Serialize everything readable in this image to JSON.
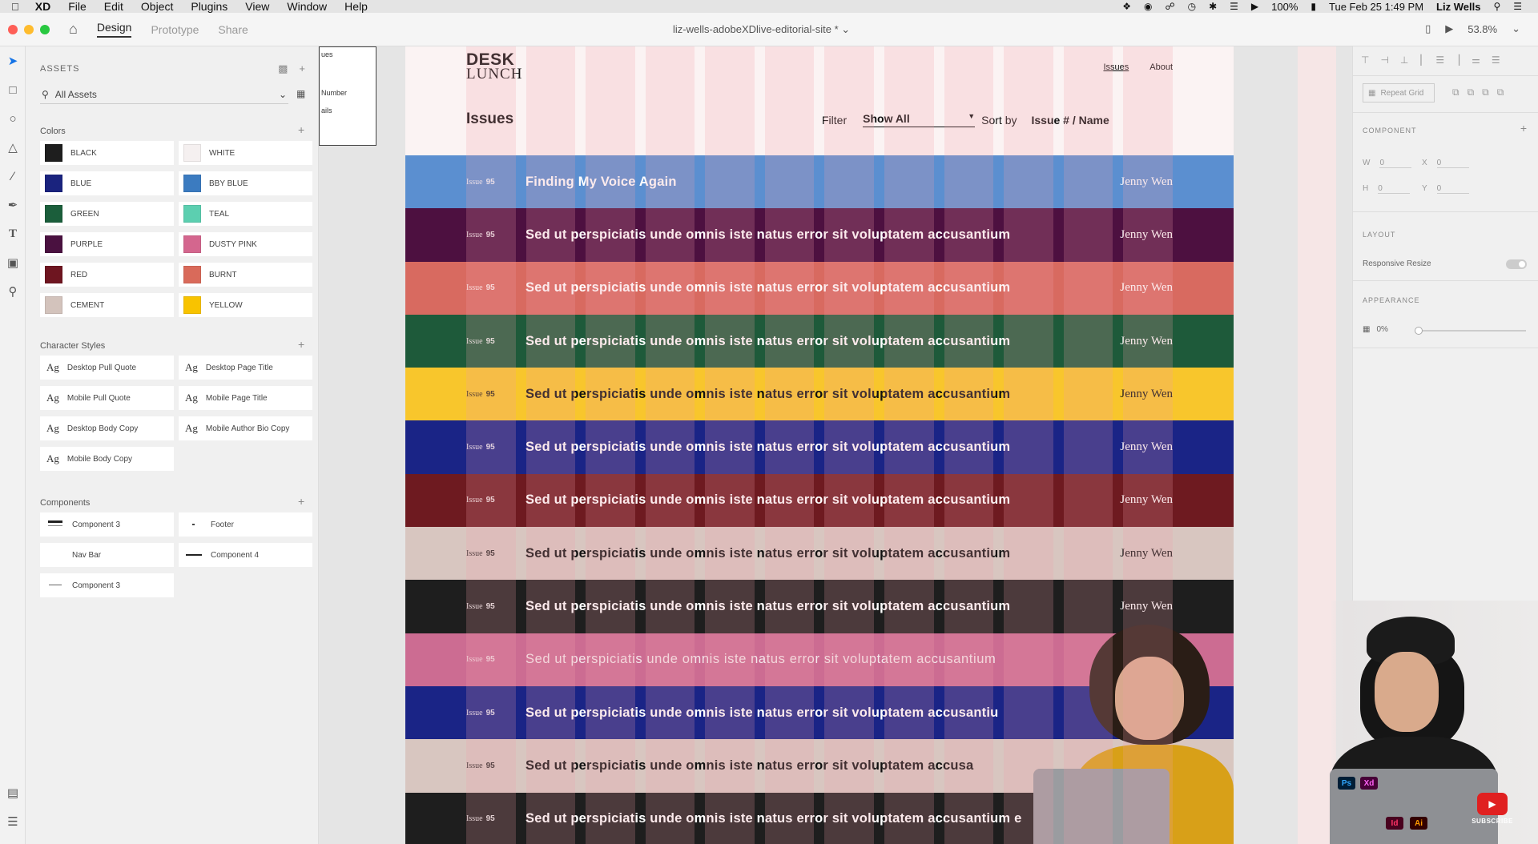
{
  "menubar": {
    "app": "XD",
    "items": [
      "File",
      "Edit",
      "Object",
      "Plugins",
      "View",
      "Window",
      "Help"
    ],
    "battery": "100%",
    "clock": "Tue Feb 25  1:49 PM",
    "user": "Liz Wells"
  },
  "titlebar": {
    "tabs": [
      "Design",
      "Prototype",
      "Share"
    ],
    "document": "liz-wells-adobeXDlive-editorial-site *",
    "zoom": "53.8%"
  },
  "assets": {
    "header": "ASSETS",
    "search_value": "All Assets",
    "colors_title": "Colors",
    "colors": [
      {
        "name": "BLACK",
        "hex": "#1e1e1e"
      },
      {
        "name": "WHITE",
        "hex": "#f5f0f0"
      },
      {
        "name": "BLUE",
        "hex": "#1a237e"
      },
      {
        "name": "BBY BLUE",
        "hex": "#3b7bc0"
      },
      {
        "name": "GREEN",
        "hex": "#1b5e3b"
      },
      {
        "name": "TEAL",
        "hex": "#5ccfb0"
      },
      {
        "name": "PURPLE",
        "hex": "#4a1140"
      },
      {
        "name": "DUSTY PINK",
        "hex": "#d4668e"
      },
      {
        "name": "RED",
        "hex": "#6e1520"
      },
      {
        "name": "BURNT",
        "hex": "#d96a5a"
      },
      {
        "name": "CEMENT",
        "hex": "#d3c3bc"
      },
      {
        "name": "YELLOW",
        "hex": "#f8c300"
      }
    ],
    "char_styles_title": "Character Styles",
    "char_styles": [
      "Desktop Pull Quote",
      "Desktop Page Title",
      "Mobile Pull Quote",
      "Mobile Page Title",
      "Desktop Body Copy",
      "Mobile Author Bio Copy",
      "Mobile Body Copy"
    ],
    "components_title": "Components",
    "components": [
      "Component 3",
      "Footer",
      "Nav Bar",
      "Component 4",
      "Component 3"
    ]
  },
  "mini_board": {
    "title": "ues",
    "line1": "Number",
    "line2": "ails"
  },
  "artboard": {
    "logo_line1": "DESK",
    "logo_line2": "LUNCH",
    "nav": [
      "Issues",
      "About"
    ],
    "title": "Issues",
    "filter_label": "Filter",
    "filter_value": "Show All",
    "sort_label": "Sort by",
    "sort_value": "Issue # / Name",
    "rows": [
      {
        "issue_word": "Issue",
        "issue_num": "95",
        "title": "Finding My Voice Again",
        "author": "Jenny Wen",
        "bg": "#5b8fd0",
        "fg": "#ffffff"
      },
      {
        "issue_word": "Issue",
        "issue_num": "95",
        "title": "Sed ut perspiciatis unde omnis iste natus error sit voluptatem accusantium",
        "author": "Jenny Wen",
        "bg": "#4d1040",
        "fg": "#ffffff"
      },
      {
        "issue_word": "Issue",
        "issue_num": "95",
        "title": "Sed ut perspiciatis unde omnis iste natus error sit voluptatem accusantium",
        "author": "Jenny Wen",
        "bg": "#d86a60",
        "fg": "#ffffff"
      },
      {
        "issue_word": "Issue",
        "issue_num": "95",
        "title": "Sed ut perspiciatis unde omnis iste natus error sit voluptatem accusantium",
        "author": "Jenny Wen",
        "bg": "#1e5a3a",
        "fg": "#ffffff"
      },
      {
        "issue_word": "Issue",
        "issue_num": "95",
        "title": "Sed ut perspiciatis unde omnis iste natus error sit voluptatem accusantium",
        "author": "Jenny Wen",
        "bg": "#f8c62c",
        "fg": "#111111"
      },
      {
        "issue_word": "Issue",
        "issue_num": "95",
        "title": "Sed ut perspiciatis unde omnis iste natus error sit voluptatem accusantium",
        "author": "Jenny Wen",
        "bg": "#1a2486",
        "fg": "#ffffff"
      },
      {
        "issue_word": "Issue",
        "issue_num": "95",
        "title": "Sed ut perspiciatis unde omnis iste natus error sit voluptatem accusantium",
        "author": "Jenny Wen",
        "bg": "#6e1a20",
        "fg": "#ffffff"
      },
      {
        "issue_word": "Issue",
        "issue_num": "95",
        "title": "Sed ut perspiciatis unde omnis iste natus error sit voluptatem accusantium",
        "author": "Jenny Wen",
        "bg": "#d8c6c0",
        "fg": "#111111"
      },
      {
        "issue_word": "Issue",
        "issue_num": "95",
        "title": "Sed ut perspiciatis unde omnis iste natus error sit voluptatem accusantium",
        "author": "Jenny Wen",
        "bg": "#1e1e1e",
        "fg": "#ffffff"
      },
      {
        "issue_word": "Issue",
        "issue_num": "95",
        "title": "Sed ut perspiciatis unde omnis iste natus error sit voluptatem accusantium",
        "author": "Jenny Wen",
        "bg": "#cc6c92",
        "fg": "#f4e6ea"
      },
      {
        "issue_word": "Issue",
        "issue_num": "95",
        "title": "Sed ut perspiciatis unde omnis iste natus error sit voluptatem accusantiu",
        "author": "",
        "bg": "#1a2486",
        "fg": "#ffffff"
      },
      {
        "issue_word": "Issue",
        "issue_num": "95",
        "title": "Sed ut perspiciatis unde omnis iste natus error sit voluptatem accusa",
        "author": "",
        "bg": "#d8c6c0",
        "fg": "#111111"
      },
      {
        "issue_word": "Issue",
        "issue_num": "95",
        "title": "Sed ut perspiciatis unde omnis iste natus error sit voluptatem accusantium e",
        "author": "",
        "bg": "#1e1e1e",
        "fg": "#ffffff"
      }
    ]
  },
  "props": {
    "repeat_grid": "Repeat Grid",
    "component_title": "COMPONENT",
    "w_label": "W",
    "w_value": "0",
    "x_label": "X",
    "x_value": "0",
    "h_label": "H",
    "h_value": "0",
    "y_label": "Y",
    "y_value": "0",
    "layout_title": "LAYOUT",
    "responsive_resize": "Responsive Resize",
    "appearance_title": "APPEARANCE",
    "opacity": "0%"
  },
  "webcam": {
    "sticker_ps": "Ps",
    "sticker_xd": "Xd",
    "sticker_id": "Id",
    "sticker_ai": "Ai",
    "subscribe": "SUBSCRIBE"
  }
}
